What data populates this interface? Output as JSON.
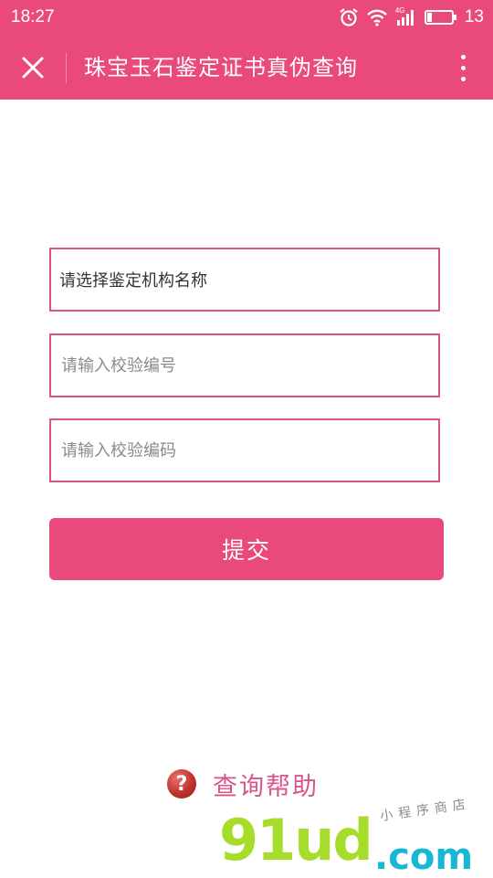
{
  "statusbar": {
    "time": "18:27",
    "network_label": "4G",
    "battery": "13"
  },
  "header": {
    "title": "珠宝玉石鉴定证书真伪查询"
  },
  "form": {
    "institution_select": "请选择鉴定机构名称",
    "number_placeholder": "请输入校验编号",
    "code_placeholder": "请输入校验编码",
    "submit_label": "提交"
  },
  "help": {
    "icon": "?",
    "label": "查询帮助"
  },
  "watermark": {
    "main": "91ud",
    "dotcom": ".com",
    "tagline": "小程序商店"
  },
  "colors": {
    "accent": "#e94a7b",
    "field_border": "#d9548a",
    "help_text": "#d9548a"
  }
}
